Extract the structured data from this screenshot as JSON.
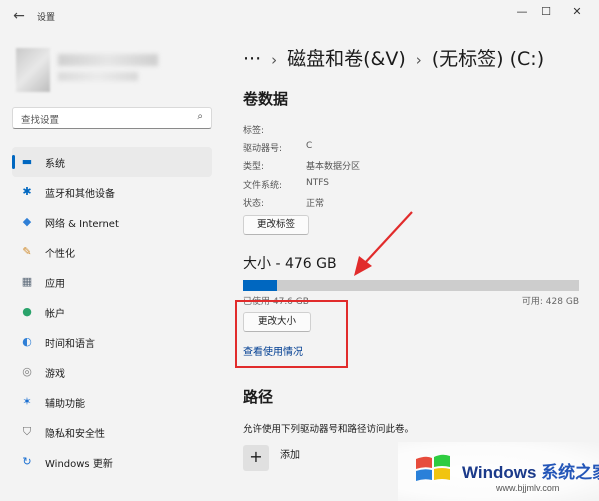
{
  "window": {
    "title": "设置",
    "controls": {
      "minimize": "—",
      "maximize": "☐",
      "close": "✕"
    },
    "back_icon": "←"
  },
  "sidebar": {
    "search": {
      "placeholder": "查找设置",
      "icon": "⌕"
    },
    "items": [
      {
        "label": "系统",
        "icon": "▬",
        "icon_name": "monitor-icon",
        "color": "#0067c0",
        "active": true
      },
      {
        "label": "蓝牙和其他设备",
        "icon": "✱",
        "icon_name": "bluetooth-icon",
        "color": "#0067c0"
      },
      {
        "label": "网络 & Internet",
        "icon": "◆",
        "icon_name": "wifi-icon",
        "color": "#2f7fd6"
      },
      {
        "label": "个性化",
        "icon": "✎",
        "icon_name": "brush-icon",
        "color": "#d08a2a"
      },
      {
        "label": "应用",
        "icon": "▦",
        "icon_name": "apps-icon",
        "color": "#5d6b7a"
      },
      {
        "label": "帐户",
        "icon": "●",
        "icon_name": "account-icon",
        "color": "#2aa36b"
      },
      {
        "label": "时间和语言",
        "icon": "◐",
        "icon_name": "clock-globe-icon",
        "color": "#2f7fd6"
      },
      {
        "label": "游戏",
        "icon": "◎",
        "icon_name": "gamepad-icon",
        "color": "#7a7a7a"
      },
      {
        "label": "辅助功能",
        "icon": "✶",
        "icon_name": "accessibility-icon",
        "color": "#1a6fd1"
      },
      {
        "label": "隐私和安全性",
        "icon": "⛉",
        "icon_name": "shield-icon",
        "color": "#6b6b6b"
      },
      {
        "label": "Windows 更新",
        "icon": "↻",
        "icon_name": "update-icon",
        "color": "#1a6fd1"
      }
    ]
  },
  "main": {
    "breadcrumb": {
      "more": "···",
      "sep": "›",
      "parent": "磁盘和卷(&V)",
      "current": "(无标签) (C:)"
    },
    "volume": {
      "title": "卷数据",
      "rows": [
        {
          "key": "标签:",
          "value": ""
        },
        {
          "key": "驱动器号:",
          "value": "C"
        },
        {
          "key": "类型:",
          "value": "基本数据分区"
        },
        {
          "key": "文件系统:",
          "value": "NTFS"
        },
        {
          "key": "状态:",
          "value": "正常"
        }
      ],
      "change_label_button": "更改标签"
    },
    "size": {
      "title": "大小 - 476 GB",
      "used_label": "已使用 47.6 GB",
      "free_label": "可用: 428 GB",
      "used_fraction": 0.1,
      "resize_button": "更改大小",
      "usage_link": "查看使用情况"
    },
    "path": {
      "title": "路径",
      "description": "允许使用下列驱动器号和路径访问此卷。",
      "add_icon": "+",
      "add_label": "添加"
    }
  },
  "colors": {
    "accent": "#0067c0",
    "annotation": "#e12b2b"
  },
  "watermark": {
    "title": "Windows",
    "title_cn": "系统之家",
    "url": "www.bjjmlv.com"
  }
}
